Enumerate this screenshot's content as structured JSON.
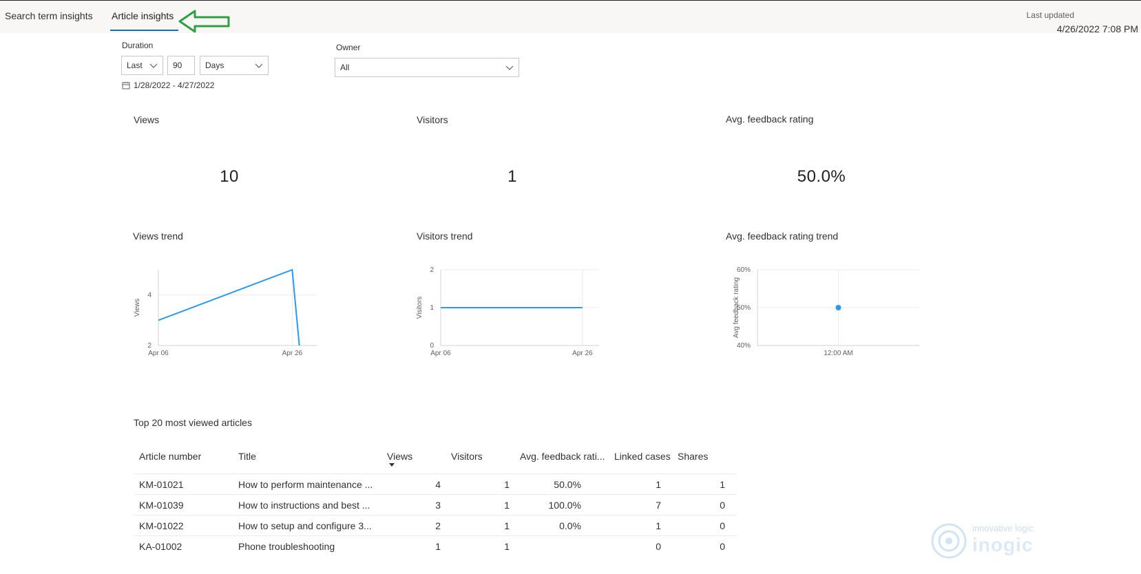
{
  "tabs": {
    "search_term_insights": "Search term insights",
    "article_insights": "Article insights"
  },
  "last_updated": {
    "label": "Last updated",
    "value": "4/26/2022 7:08 PM"
  },
  "filters": {
    "duration_label": "Duration",
    "duration_qualifier": "Last",
    "duration_amount": "90",
    "duration_unit": "Days",
    "owner_label": "Owner",
    "owner_value": "All",
    "date_range": "1/28/2022 - 4/27/2022"
  },
  "kpis": {
    "views_title": "Views",
    "views_value": "10",
    "visitors_title": "Visitors",
    "visitors_value": "1",
    "feedback_title": "Avg. feedback rating",
    "feedback_value": "50.0%"
  },
  "trends": {
    "views_trend_title": "Views trend",
    "visitors_trend_title": "Visitors trend",
    "feedback_trend_title": "Avg. feedback rating trend"
  },
  "chart_data": [
    {
      "type": "line",
      "ylabel": "Views",
      "x_ticks": [
        "Apr 06",
        "Apr 26"
      ],
      "y_ticks": [
        "2",
        "4"
      ],
      "ylim": [
        2,
        5
      ],
      "series": [
        {
          "x": [
            "Apr 06",
            "Apr 26",
            "Apr 26+"
          ],
          "values": [
            3,
            5,
            2
          ]
        }
      ],
      "grid": true
    },
    {
      "type": "line",
      "ylabel": "Visitors",
      "x_ticks": [
        "Apr 06",
        "Apr 26"
      ],
      "y_ticks": [
        "0",
        "1",
        "2"
      ],
      "ylim": [
        0,
        2
      ],
      "series": [
        {
          "x": [
            "Apr 06",
            "Apr 26"
          ],
          "values": [
            1,
            1
          ]
        }
      ],
      "grid": true
    },
    {
      "type": "scatter",
      "ylabel": "Avg feedback rating",
      "x_ticks": [
        "12:00 AM"
      ],
      "y_ticks": [
        "40%",
        "50%",
        "60%"
      ],
      "ylim": [
        40,
        60
      ],
      "series": [
        {
          "x": [
            "12:00 AM"
          ],
          "values": [
            50
          ]
        }
      ],
      "grid": true
    }
  ],
  "table": {
    "title": "Top 20 most viewed articles",
    "headers": {
      "article_number": "Article number",
      "title": "Title",
      "views": "Views",
      "visitors": "Visitors",
      "feedback": "Avg. feedback rati...",
      "linked_cases": "Linked cases",
      "shares": "Shares"
    },
    "rows": [
      {
        "article_number": "KM-01021",
        "title": "How to perform maintenance ...",
        "views": "4",
        "visitors": "1",
        "feedback": "50.0%",
        "linked_cases": "1",
        "shares": "1"
      },
      {
        "article_number": "KM-01039",
        "title": "How to instructions and best ...",
        "views": "3",
        "visitors": "1",
        "feedback": "100.0%",
        "linked_cases": "7",
        "shares": "0"
      },
      {
        "article_number": "KM-01022",
        "title": "How to setup and configure 3...",
        "views": "2",
        "visitors": "1",
        "feedback": "0.0%",
        "linked_cases": "1",
        "shares": "0"
      },
      {
        "article_number": "KA-01002",
        "title": "Phone troubleshooting",
        "views": "1",
        "visitors": "1",
        "feedback": "",
        "linked_cases": "0",
        "shares": "0"
      }
    ]
  },
  "watermark": {
    "line1": "innovative logic",
    "line2": "inogic"
  },
  "colors": {
    "accent": "#106ebe",
    "series": "#2899f5",
    "arrow": "#2ea043"
  }
}
